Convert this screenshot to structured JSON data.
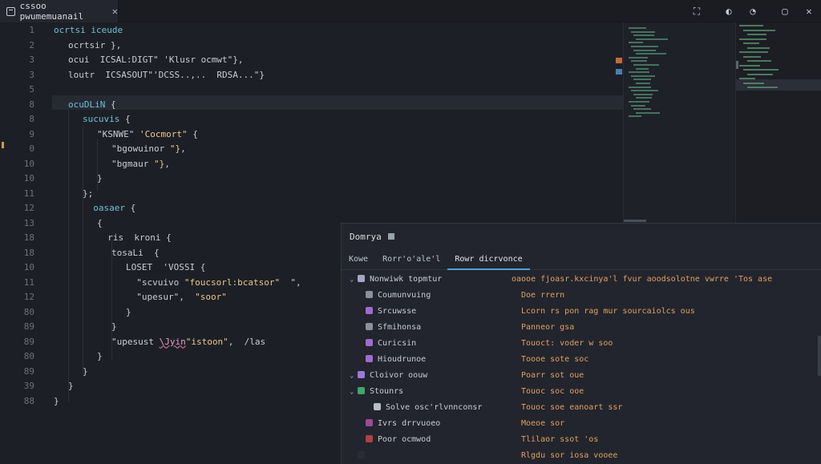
{
  "tab": {
    "title": "cssoo pwumemuanail",
    "close": "✕"
  },
  "title_actions": [
    "⛶",
    "◐",
    "◔",
    "▢",
    "✕"
  ],
  "editor": {
    "lines": [
      {
        "no": "1",
        "indent": 0,
        "parts": [
          {
            "c": "k",
            "t": "ocrtsi iceude"
          }
        ]
      },
      {
        "no": "2",
        "indent": 1,
        "parts": [
          {
            "c": "p",
            "t": "ocrtsir },"
          }
        ]
      },
      {
        "no": "3",
        "indent": 1,
        "parts": [
          {
            "c": "p",
            "t": "ocui  ICSAL:DIGT\" 'Klusr ocmwt\"},"
          }
        ]
      },
      {
        "no": "3",
        "indent": 1,
        "parts": [
          {
            "c": "p",
            "t": "loutr  ICSASOUT\"'DCSS..,..  RDSA...\"}"
          }
        ]
      },
      {
        "no": "5",
        "indent": 0,
        "parts": []
      },
      {
        "no": "8",
        "indent": 1,
        "parts": [
          {
            "c": "k",
            "t": "ocuDLiN"
          },
          {
            "c": "p",
            "t": " {"
          }
        ]
      },
      {
        "no": "8",
        "indent": 2,
        "parts": [
          {
            "c": "k",
            "t": "sucuvis"
          },
          {
            "c": "p",
            "t": " {"
          }
        ]
      },
      {
        "no": "9",
        "indent": 3,
        "parts": [
          {
            "c": "p",
            "t": "\"KSNWE\" "
          },
          {
            "c": "s",
            "t": "'Cocmort\""
          },
          {
            "c": "p",
            "t": " {"
          }
        ]
      },
      {
        "no": "0",
        "indent": 4,
        "parts": [
          {
            "c": "p",
            "t": "\"bgowuinor "
          },
          {
            "c": "s",
            "t": "\"}"
          },
          {
            "c": "p",
            "t": ","
          }
        ]
      },
      {
        "no": "10",
        "indent": 4,
        "parts": [
          {
            "c": "p",
            "t": "\"bgmaur "
          },
          {
            "c": "s",
            "t": "\"}"
          },
          {
            "c": "p",
            "t": ","
          }
        ]
      },
      {
        "no": "10",
        "indent": 3,
        "parts": [
          {
            "c": "p",
            "t": "}"
          }
        ]
      },
      {
        "no": "11",
        "indent": 2,
        "parts": [
          {
            "c": "p",
            "t": "};"
          }
        ]
      },
      {
        "no": "12",
        "indent": 2,
        "parts": [
          {
            "c": "k",
            "t": "  oasaer"
          },
          {
            "c": "p",
            "t": " {"
          }
        ]
      },
      {
        "no": "13",
        "indent": 3,
        "parts": [
          {
            "c": "p",
            "t": "{"
          }
        ]
      },
      {
        "no": "18",
        "indent": 3,
        "parts": [
          {
            "c": "p",
            "t": "  ris  kroni"
          },
          {
            "c": "p",
            "t": " {"
          }
        ]
      },
      {
        "no": "18",
        "indent": 4,
        "parts": [
          {
            "c": "p",
            "t": "tosaLi  {"
          }
        ]
      },
      {
        "no": "10",
        "indent": 5,
        "parts": [
          {
            "c": "p",
            "t": "LOSET  'VOSSI"
          },
          {
            "c": "p",
            "t": " {"
          }
        ]
      },
      {
        "no": "11",
        "indent": 5,
        "parts": [
          {
            "c": "p",
            "t": "  \"scvuivo "
          },
          {
            "c": "s",
            "t": "\"foucsorl:bcatsor\""
          },
          {
            "c": "p",
            "t": "  \","
          }
        ]
      },
      {
        "no": "12",
        "indent": 5,
        "parts": [
          {
            "c": "p",
            "t": "  \"upesur\","
          },
          {
            "c": "s",
            "t": "  \"soor\""
          }
        ]
      },
      {
        "no": "80",
        "indent": 5,
        "parts": [
          {
            "c": "p",
            "t": "}"
          }
        ]
      },
      {
        "no": "89",
        "indent": 4,
        "parts": [
          {
            "c": "p",
            "t": "}"
          }
        ]
      },
      {
        "no": "89",
        "indent": 4,
        "parts": [
          {
            "c": "p",
            "t": "\"upesust "
          },
          {
            "c": "err",
            "t": "\\Jyin"
          },
          {
            "c": "s",
            "t": "\"istoon\""
          },
          {
            "c": "p",
            "t": ",  /las"
          }
        ]
      },
      {
        "no": "80",
        "indent": 3,
        "parts": [
          {
            "c": "p",
            "t": "}"
          }
        ]
      },
      {
        "no": "89",
        "indent": 2,
        "parts": [
          {
            "c": "p",
            "t": "}"
          }
        ]
      },
      {
        "no": "39",
        "indent": 1,
        "parts": [
          {
            "c": "p",
            "t": "}"
          }
        ]
      },
      {
        "no": "88",
        "indent": 0,
        "parts": [
          {
            "c": "p",
            "t": "}"
          }
        ]
      }
    ]
  },
  "panel": {
    "title": "Domrya",
    "tabs": [
      {
        "label": "Kowe",
        "active": false
      },
      {
        "label": "Rorr'o'ale'l",
        "active": false
      },
      {
        "label": "Rowr dicrvonce",
        "active": true
      }
    ],
    "tree": [
      {
        "label": "Nonwiwk topmtur",
        "chev": "⌄",
        "color": "#a9a3c7",
        "depth": 0
      },
      {
        "label": "Coumunvuing",
        "chev": "",
        "color": "#8b90a0",
        "depth": 1
      },
      {
        "label": "Srcuwsse",
        "chev": "",
        "color": "#a06ad0",
        "depth": 1
      },
      {
        "label": "Sfmihonsa",
        "chev": "",
        "color": "#8b90a0",
        "depth": 1
      },
      {
        "label": "Curicsin",
        "chev": "",
        "color": "#a06ad0",
        "depth": 1
      },
      {
        "label": "Hioudrunoe",
        "chev": "",
        "color": "#a06ad0",
        "depth": 1
      },
      {
        "label": "Cloivor oouw",
        "chev": "⌄",
        "color": "#9a7ad8",
        "depth": 0
      },
      {
        "label": "Stounrs",
        "chev": "⌄",
        "color": "#3fa66a",
        "depth": 0
      },
      {
        "label": "Solve osc'rlvnnconsr",
        "chev": "",
        "color": "#b9bdc6",
        "depth": 2
      },
      {
        "label": "Ivrs drrvuoeo",
        "chev": "",
        "color": "#9a4a9a",
        "depth": 1
      },
      {
        "label": "Poor ocmwod",
        "chev": "",
        "color": "#b0413f",
        "depth": 1
      },
      {
        "label": "",
        "chev": "",
        "color": "#2a2d35",
        "depth": 0
      }
    ],
    "details": [
      "oaooe fjoasr.kxcinya'l fvur aoodsolotne  vwrre  'Tos ase",
      "Doe  rrern",
      "Lcorn  rs  pon  rag  mur  sourcaiolcs  ous",
      "Panneor  gsa",
      "Touoct:  voder  w  soo",
      "Toooe  sote  soc",
      "Poarr  sot  oue",
      "Touoc  soc  ooe",
      "Touoc  soe  eanoart  ssr",
      "Moeoe  sor",
      "Tlilaor  ssot  'os",
      "Rlgdu  sor  iosa  vooee"
    ]
  },
  "colors": {
    "background": "#1d1f26",
    "keyword": "#6ec0d6",
    "string": "#e7c987",
    "detail_text": "#e0a062",
    "accent": "#4aa3d8"
  }
}
